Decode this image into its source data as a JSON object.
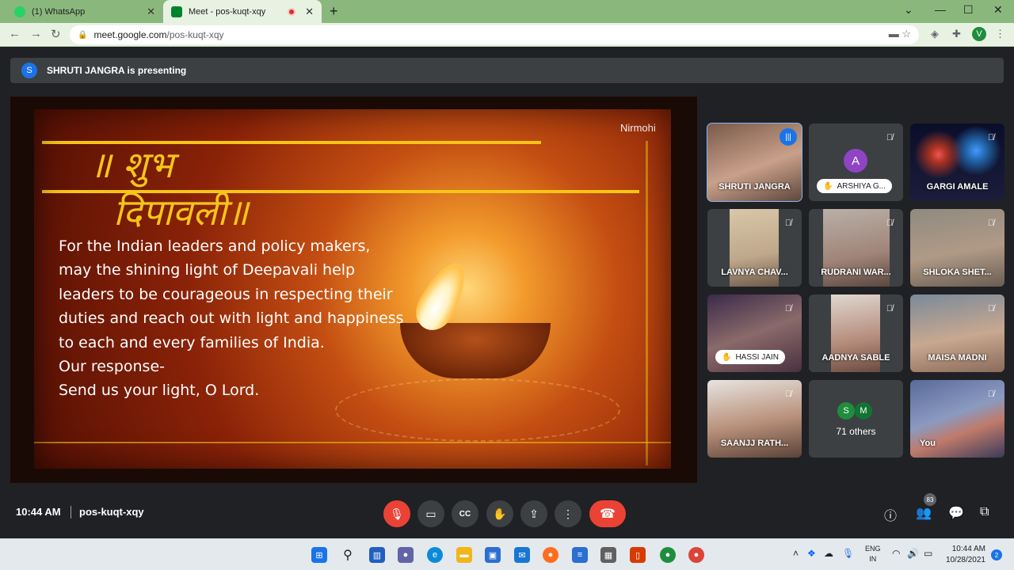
{
  "browser": {
    "tabs": [
      {
        "title": "(1) WhatsApp",
        "active": false,
        "icon": "whatsapp-icon",
        "color": "#25d366"
      },
      {
        "title": "Meet - pos-kuqt-xqy",
        "active": true,
        "icon": "google-meet-icon",
        "color": "#00832d"
      }
    ],
    "new_tab": "+",
    "url_host": "meet.google.com",
    "url_path": "/pos-kuqt-xqy",
    "profile_initial": "V"
  },
  "meet": {
    "presenting_initial": "S",
    "presenting_text": "SHRUTI JANGRA is presenting",
    "slide": {
      "title_line1": "॥ शुभ",
      "title_line2": "दिपावली॥",
      "author": "Nirmohi",
      "body": "For the Indian leaders and policy makers, may the shining light of Deepavali help leaders to be courageous in respecting their duties and reach out with light and happiness to each and every families of India.",
      "response_label": "Our response-",
      "response": "Send us your light, O Lord."
    },
    "participants": [
      {
        "name": "SHRUTI JANGRA",
        "speaking": true
      },
      {
        "name": "ARSHIYA G...",
        "avatar": "A",
        "hand_raised": true,
        "muted": true
      },
      {
        "name": "GARGI AMALE",
        "muted": true
      },
      {
        "name": "LAVNYA CHAV...",
        "muted": true
      },
      {
        "name": "RUDRANI WAR...",
        "muted": true
      },
      {
        "name": "SHLOKA SHET...",
        "muted": true
      },
      {
        "name": "HASSI JAIN",
        "hand_raised": true,
        "muted": true
      },
      {
        "name": "AADNYA SABLE",
        "muted": true
      },
      {
        "name": "MAISA MADNI",
        "muted": true
      },
      {
        "name": "SAANJJ RATH...",
        "muted": true
      },
      {
        "name": "You",
        "muted": true
      }
    ],
    "others": {
      "initials": [
        "S",
        "M"
      ],
      "label": "71 others"
    },
    "time": "10:44 AM",
    "meeting_code": "pos-kuqt-xqy",
    "people_count": "83"
  },
  "taskbar": {
    "lang_line1": "ENG",
    "lang_line2": "IN",
    "time": "10:44 AM",
    "date": "10/28/2021",
    "notifications": "2"
  }
}
